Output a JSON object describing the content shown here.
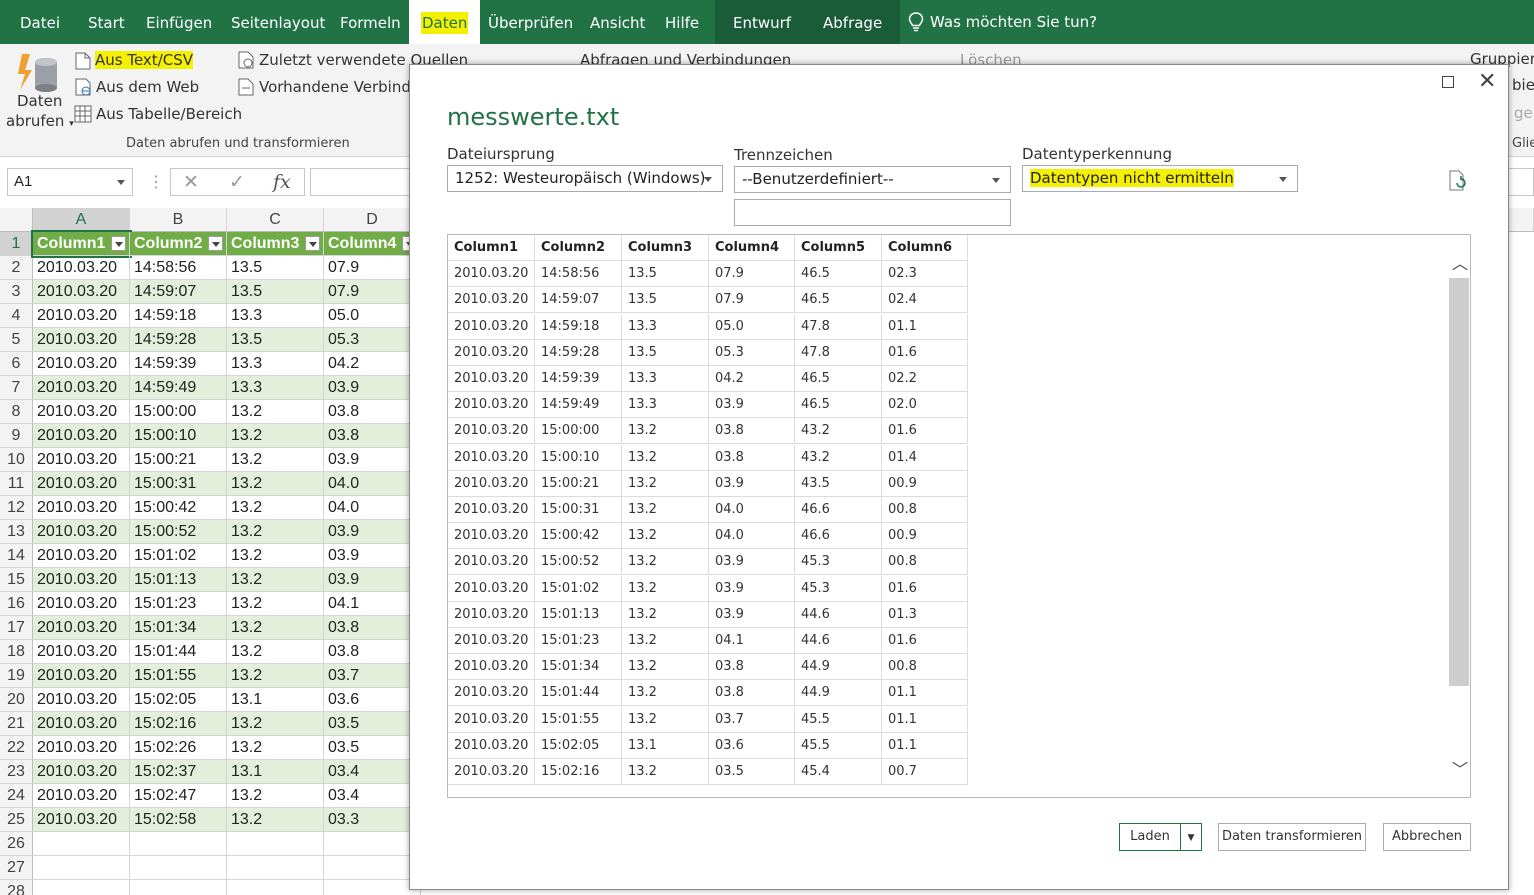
{
  "ribbon_tabs": [
    {
      "label": "Datei"
    },
    {
      "label": "Start"
    },
    {
      "label": "Einfügen"
    },
    {
      "label": "Seitenlayout"
    },
    {
      "label": "Formeln"
    },
    {
      "label": "Daten"
    },
    {
      "label": "Überprüfen"
    },
    {
      "label": "Ansicht"
    },
    {
      "label": "Hilfe"
    },
    {
      "label": "Entwurf"
    },
    {
      "label": "Abfrage"
    }
  ],
  "tell_me": "Was möchten Sie tun?",
  "ribbon": {
    "get_data_line1": "Daten",
    "get_data_line2": "abrufen",
    "from_text_csv": "Aus Text/CSV",
    "from_web": "Aus dem Web",
    "from_table": "Aus Tabelle/Bereich",
    "recent_sources": "Zuletzt verwendete Quellen",
    "existing_connections": "Vorhandene Verbindun",
    "queries_connections": "Abfragen und Verbindungen",
    "delete": "Löschen",
    "group": "Gruppiere",
    "group_label_get": "Daten abrufen und transformieren",
    "partial_bieru": "bieru",
    "partial_geb": "geb",
    "group_label_outline": "Glie"
  },
  "formula_bar": {
    "name_box": "A1",
    "fx_label": "fx",
    "formula": ""
  },
  "sheet": {
    "columns": [
      "A",
      "B",
      "C",
      "D"
    ],
    "header_row": [
      "Column1",
      "Column2",
      "Column3",
      "Column4"
    ],
    "rows": [
      [
        "2010.03.20",
        "14:58:56",
        "13.5",
        "07.9"
      ],
      [
        "2010.03.20",
        "14:59:07",
        "13.5",
        "07.9"
      ],
      [
        "2010.03.20",
        "14:59:18",
        "13.3",
        "05.0"
      ],
      [
        "2010.03.20",
        "14:59:28",
        "13.5",
        "05.3"
      ],
      [
        "2010.03.20",
        "14:59:39",
        "13.3",
        "04.2"
      ],
      [
        "2010.03.20",
        "14:59:49",
        "13.3",
        "03.9"
      ],
      [
        "2010.03.20",
        "15:00:00",
        "13.2",
        "03.8"
      ],
      [
        "2010.03.20",
        "15:00:10",
        "13.2",
        "03.8"
      ],
      [
        "2010.03.20",
        "15:00:21",
        "13.2",
        "03.9"
      ],
      [
        "2010.03.20",
        "15:00:31",
        "13.2",
        "04.0"
      ],
      [
        "2010.03.20",
        "15:00:42",
        "13.2",
        "04.0"
      ],
      [
        "2010.03.20",
        "15:00:52",
        "13.2",
        "03.9"
      ],
      [
        "2010.03.20",
        "15:01:02",
        "13.2",
        "03.9"
      ],
      [
        "2010.03.20",
        "15:01:13",
        "13.2",
        "03.9"
      ],
      [
        "2010.03.20",
        "15:01:23",
        "13.2",
        "04.1"
      ],
      [
        "2010.03.20",
        "15:01:34",
        "13.2",
        "03.8"
      ],
      [
        "2010.03.20",
        "15:01:44",
        "13.2",
        "03.8"
      ],
      [
        "2010.03.20",
        "15:01:55",
        "13.2",
        "03.7"
      ],
      [
        "2010.03.20",
        "15:02:05",
        "13.1",
        "03.6"
      ],
      [
        "2010.03.20",
        "15:02:16",
        "13.2",
        "03.5"
      ],
      [
        "2010.03.20",
        "15:02:26",
        "13.2",
        "03.5"
      ],
      [
        "2010.03.20",
        "15:02:37",
        "13.1",
        "03.4"
      ],
      [
        "2010.03.20",
        "15:02:47",
        "13.2",
        "03.4"
      ],
      [
        "2010.03.20",
        "15:02:58",
        "13.2",
        "03.3"
      ]
    ],
    "row_numbers": [
      "1",
      "2",
      "3",
      "4",
      "5",
      "6",
      "7",
      "8",
      "9",
      "10",
      "11",
      "12",
      "13",
      "14",
      "15",
      "16",
      "17",
      "18",
      "19",
      "20",
      "21",
      "22",
      "23",
      "24",
      "25",
      "26",
      "27",
      "28"
    ]
  },
  "dialog": {
    "title": "messwerte.txt",
    "file_origin_label": "Dateiursprung",
    "file_origin_value": "1252: Westeuropäisch (Windows)",
    "delimiter_label": "Trennzeichen",
    "delimiter_value": "--Benutzerdefiniert--",
    "custom_delimiter": "",
    "type_detection_label": "Datentyperkennung",
    "type_detection_value": "Datentypen nicht ermitteln",
    "preview_headers": [
      "Column1",
      "Column2",
      "Column3",
      "Column4",
      "Column5",
      "Column6"
    ],
    "preview_rows": [
      [
        "2010.03.20",
        "14:58:56",
        "13.5",
        "07.9",
        "46.5",
        "02.3"
      ],
      [
        "2010.03.20",
        "14:59:07",
        "13.5",
        "07.9",
        "46.5",
        "02.4"
      ],
      [
        "2010.03.20",
        "14:59:18",
        "13.3",
        "05.0",
        "47.8",
        "01.1"
      ],
      [
        "2010.03.20",
        "14:59:28",
        "13.5",
        "05.3",
        "47.8",
        "01.6"
      ],
      [
        "2010.03.20",
        "14:59:39",
        "13.3",
        "04.2",
        "46.5",
        "02.2"
      ],
      [
        "2010.03.20",
        "14:59:49",
        "13.3",
        "03.9",
        "46.5",
        "02.0"
      ],
      [
        "2010.03.20",
        "15:00:00",
        "13.2",
        "03.8",
        "43.2",
        "01.6"
      ],
      [
        "2010.03.20",
        "15:00:10",
        "13.2",
        "03.8",
        "43.2",
        "01.4"
      ],
      [
        "2010.03.20",
        "15:00:21",
        "13.2",
        "03.9",
        "43.5",
        "00.9"
      ],
      [
        "2010.03.20",
        "15:00:31",
        "13.2",
        "04.0",
        "46.6",
        "00.8"
      ],
      [
        "2010.03.20",
        "15:00:42",
        "13.2",
        "04.0",
        "46.6",
        "00.9"
      ],
      [
        "2010.03.20",
        "15:00:52",
        "13.2",
        "03.9",
        "45.3",
        "00.8"
      ],
      [
        "2010.03.20",
        "15:01:02",
        "13.2",
        "03.9",
        "45.3",
        "01.6"
      ],
      [
        "2010.03.20",
        "15:01:13",
        "13.2",
        "03.9",
        "44.6",
        "01.3"
      ],
      [
        "2010.03.20",
        "15:01:23",
        "13.2",
        "04.1",
        "44.6",
        "01.6"
      ],
      [
        "2010.03.20",
        "15:01:34",
        "13.2",
        "03.8",
        "44.9",
        "00.8"
      ],
      [
        "2010.03.20",
        "15:01:44",
        "13.2",
        "03.8",
        "44.9",
        "01.1"
      ],
      [
        "2010.03.20",
        "15:01:55",
        "13.2",
        "03.7",
        "45.5",
        "01.1"
      ],
      [
        "2010.03.20",
        "15:02:05",
        "13.1",
        "03.6",
        "45.5",
        "01.1"
      ],
      [
        "2010.03.20",
        "15:02:16",
        "13.2",
        "03.5",
        "45.4",
        "00.7"
      ]
    ],
    "load_button": "Laden",
    "transform_button": "Daten transformieren",
    "cancel_button": "Abbrechen"
  },
  "colors": {
    "excel_green": "#217346",
    "table_header": "#70ad47",
    "table_band": "#e2efda",
    "highlight": "#f5f000"
  }
}
